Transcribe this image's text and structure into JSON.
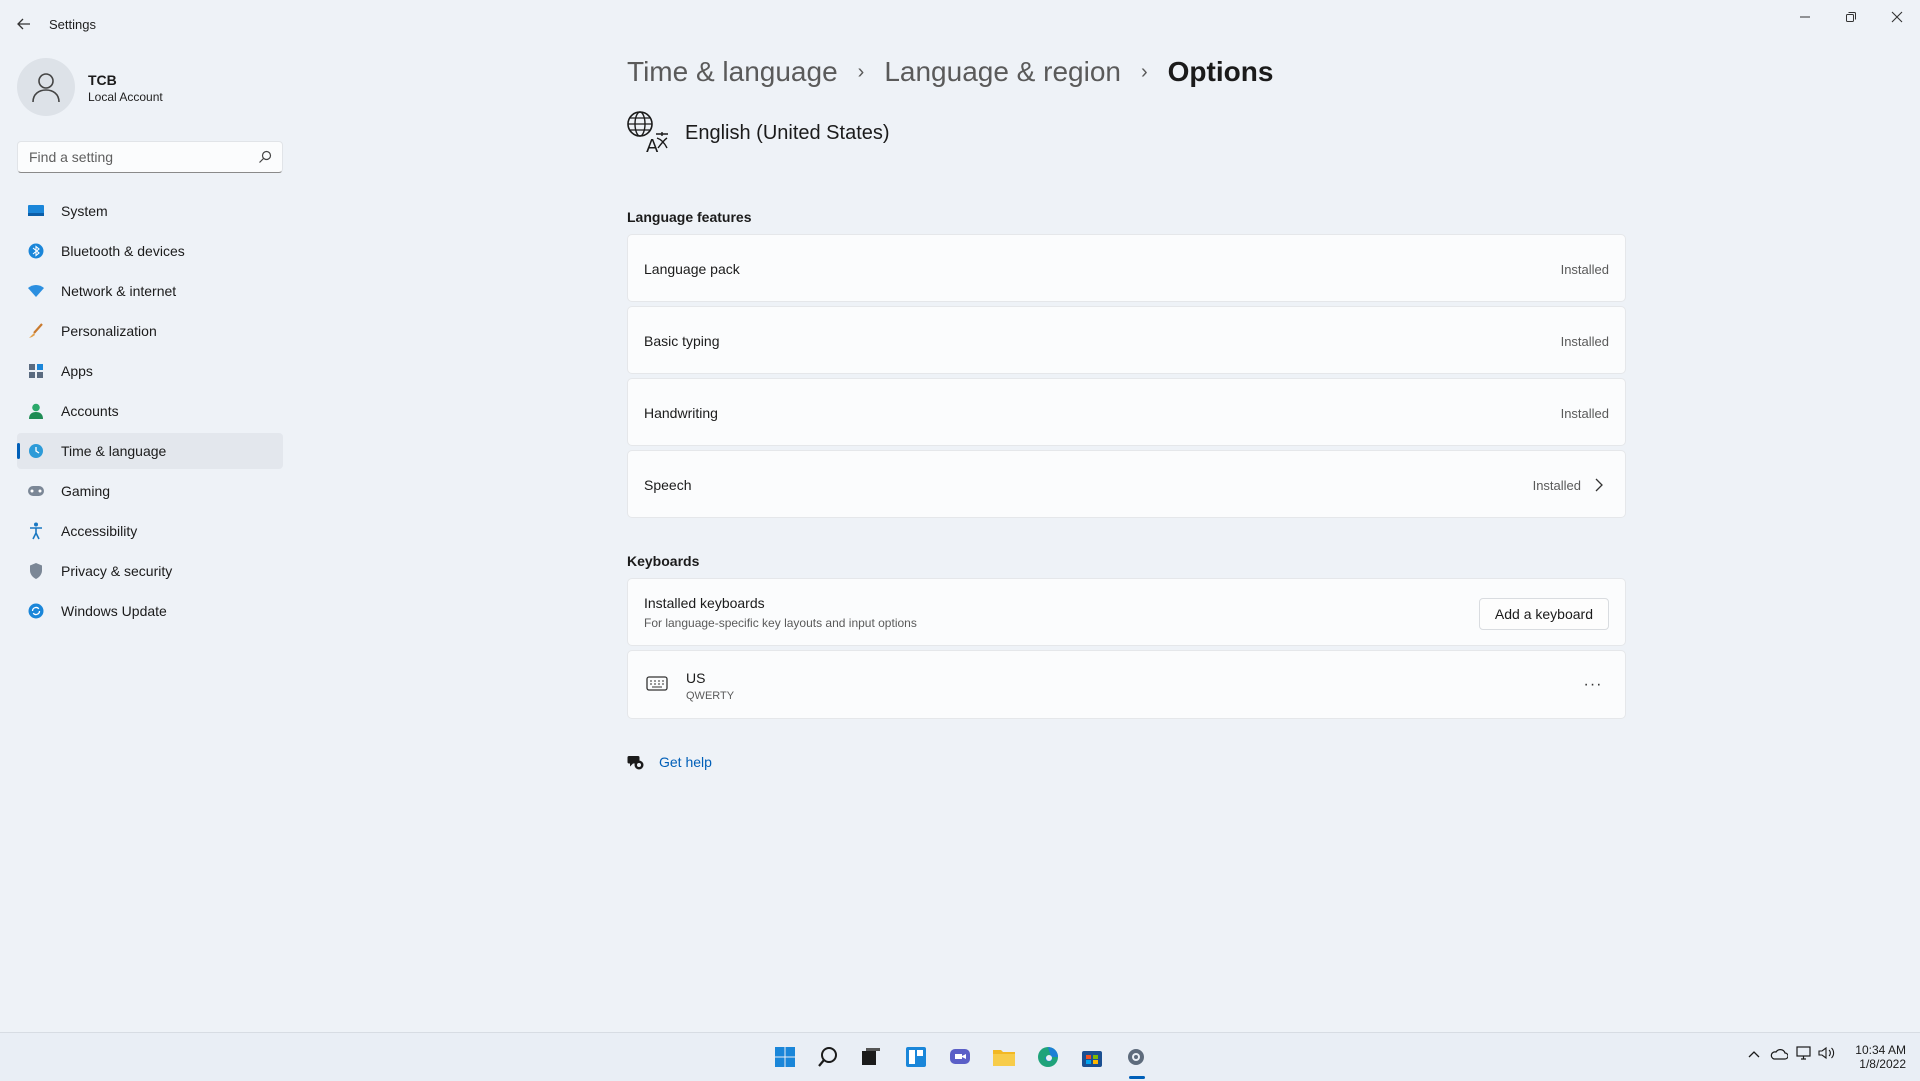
{
  "app": {
    "title": "Settings"
  },
  "profile": {
    "name": "TCB",
    "account_type": "Local Account"
  },
  "search": {
    "placeholder": "Find a setting"
  },
  "sidebar": {
    "items": [
      {
        "label": "System",
        "icon": "monitor-icon"
      },
      {
        "label": "Bluetooth & devices",
        "icon": "bluetooth-icon"
      },
      {
        "label": "Network & internet",
        "icon": "wifi-icon"
      },
      {
        "label": "Personalization",
        "icon": "brush-icon"
      },
      {
        "label": "Apps",
        "icon": "apps-icon"
      },
      {
        "label": "Accounts",
        "icon": "person-icon"
      },
      {
        "label": "Time & language",
        "icon": "globe-clock-icon",
        "active": true
      },
      {
        "label": "Gaming",
        "icon": "gamepad-icon"
      },
      {
        "label": "Accessibility",
        "icon": "accessibility-icon"
      },
      {
        "label": "Privacy & security",
        "icon": "shield-icon"
      },
      {
        "label": "Windows Update",
        "icon": "update-icon"
      }
    ]
  },
  "breadcrumb": {
    "items": [
      "Time & language",
      "Language & region",
      "Options"
    ]
  },
  "language": {
    "name": "English (United States)"
  },
  "features": {
    "title": "Language features",
    "items": [
      {
        "label": "Language pack",
        "status": "Installed"
      },
      {
        "label": "Basic typing",
        "status": "Installed"
      },
      {
        "label": "Handwriting",
        "status": "Installed"
      },
      {
        "label": "Speech",
        "status": "Installed"
      }
    ]
  },
  "keyboards": {
    "title": "Keyboards",
    "installed_label": "Installed keyboards",
    "installed_desc": "For language-specific key layouts and input options",
    "add_button": "Add a keyboard",
    "items": [
      {
        "name": "US",
        "layout": "QWERTY"
      }
    ]
  },
  "help": {
    "label": "Get help"
  },
  "taskbar": {
    "time": "10:34 AM",
    "date": "1/8/2022",
    "icons": [
      "start-icon",
      "search-icon",
      "task-view-icon",
      "widgets-icon",
      "chat-icon",
      "file-explorer-icon",
      "edge-icon",
      "store-icon",
      "settings-icon"
    ]
  },
  "colors": {
    "accent": "#005fb8",
    "background": "#eef2f7",
    "card": "#fbfcfd"
  }
}
